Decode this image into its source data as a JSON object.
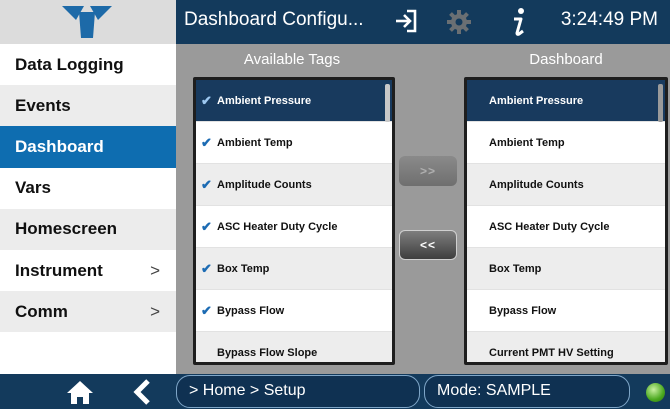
{
  "header": {
    "title": "Dashboard Configu...",
    "time": "3:24:49 PM",
    "icons": [
      "logo-icon",
      "exit-icon",
      "gear-icon",
      "info-icon"
    ]
  },
  "sidebar": {
    "items": [
      {
        "label": "Data Logging",
        "chevron": ""
      },
      {
        "label": "Events",
        "chevron": ""
      },
      {
        "label": "Dashboard",
        "chevron": ""
      },
      {
        "label": "Vars",
        "chevron": ""
      },
      {
        "label": "Homescreen",
        "chevron": ""
      },
      {
        "label": "Instrument",
        "chevron": ">"
      },
      {
        "label": "Comm",
        "chevron": ">"
      }
    ],
    "active_index": 2
  },
  "available": {
    "heading": "Available Tags",
    "check": "✔",
    "rows": [
      "Ambient Pressure",
      "Ambient Temp",
      "Amplitude Counts",
      "ASC Heater Duty Cycle",
      "Box Temp",
      "Bypass Flow",
      "Bypass Flow Slope"
    ]
  },
  "dashboard": {
    "heading": "Dashboard",
    "rows": [
      "Ambient Pressure",
      "Ambient Temp",
      "Amplitude Counts",
      "ASC Heater Duty Cycle",
      "Box Temp",
      "Bypass Flow",
      "Current PMT HV Setting"
    ]
  },
  "buttons": {
    "add": ">>",
    "remove": "<<"
  },
  "footer": {
    "breadcrumb": "> Home > Setup",
    "mode": "Mode: SAMPLE"
  },
  "colors": {
    "header": "#133a5c",
    "active": "#0e6db0",
    "selected_row": "#183a5e",
    "status_led": "#4aa81e"
  }
}
